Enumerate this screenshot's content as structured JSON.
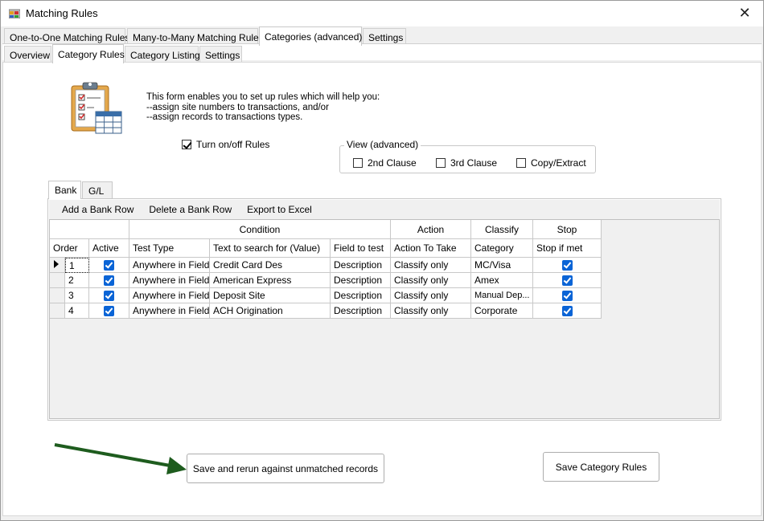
{
  "window": {
    "title": "Matching Rules",
    "close": "✕"
  },
  "main_tabs": [
    "One-to-One Matching Rules",
    "Many-to-Many Matching Rules",
    "Categories (advanced)",
    "Settings"
  ],
  "sub_tabs": [
    "Overview",
    "Category Rules",
    "Category Listing",
    "Settings"
  ],
  "description": {
    "line1": "This form enables you to set up rules which will help you:",
    "line2": "--assign site numbers to transactions, and/or",
    "line3": "--assign records to transactions types."
  },
  "turn_rules": {
    "label": "Turn on/off Rules",
    "checked": true
  },
  "view_group": {
    "legend": "View (advanced)",
    "options": [
      {
        "label": "2nd Clause",
        "checked": false
      },
      {
        "label": "3rd Clause",
        "checked": false
      },
      {
        "label": "Copy/Extract",
        "checked": false
      }
    ]
  },
  "grid_tabs": [
    "Bank",
    "G/L"
  ],
  "toolbar": {
    "add": "Add a Bank Row",
    "delete": "Delete a Bank Row",
    "export": "Export to Excel"
  },
  "group_headers": {
    "condition": "Condition",
    "action": "Action",
    "classify": "Classify",
    "stop": "Stop"
  },
  "columns": [
    "Order",
    "Active",
    "Test Type",
    "Text to search for (Value)",
    "Field to test",
    "Action To Take",
    "Category",
    "Stop if met"
  ],
  "rows": [
    {
      "order": "1",
      "test_type": "Anywhere in Field",
      "value": "Credit Card Des",
      "field": "Description",
      "action": "Classify only",
      "category": "MC/Visa"
    },
    {
      "order": "2",
      "test_type": "Anywhere in Field",
      "value": "American Express",
      "field": "Description",
      "action": "Classify only",
      "category": "Amex"
    },
    {
      "order": "3",
      "test_type": "Anywhere in Field",
      "value": "Deposit Site",
      "field": "Description",
      "action": "Classify only",
      "category": "Manual  Dep..."
    },
    {
      "order": "4",
      "test_type": "Anywhere in Field",
      "value": "ACH Origination",
      "field": "Description",
      "action": "Classify only",
      "category": "Corporate"
    }
  ],
  "buttons": {
    "save_rerun": "Save and rerun against unmatched records",
    "save": "Save Category Rules"
  },
  "colors": {
    "arrow": "#1e5c1e",
    "check_blue": "#0a64d6"
  }
}
